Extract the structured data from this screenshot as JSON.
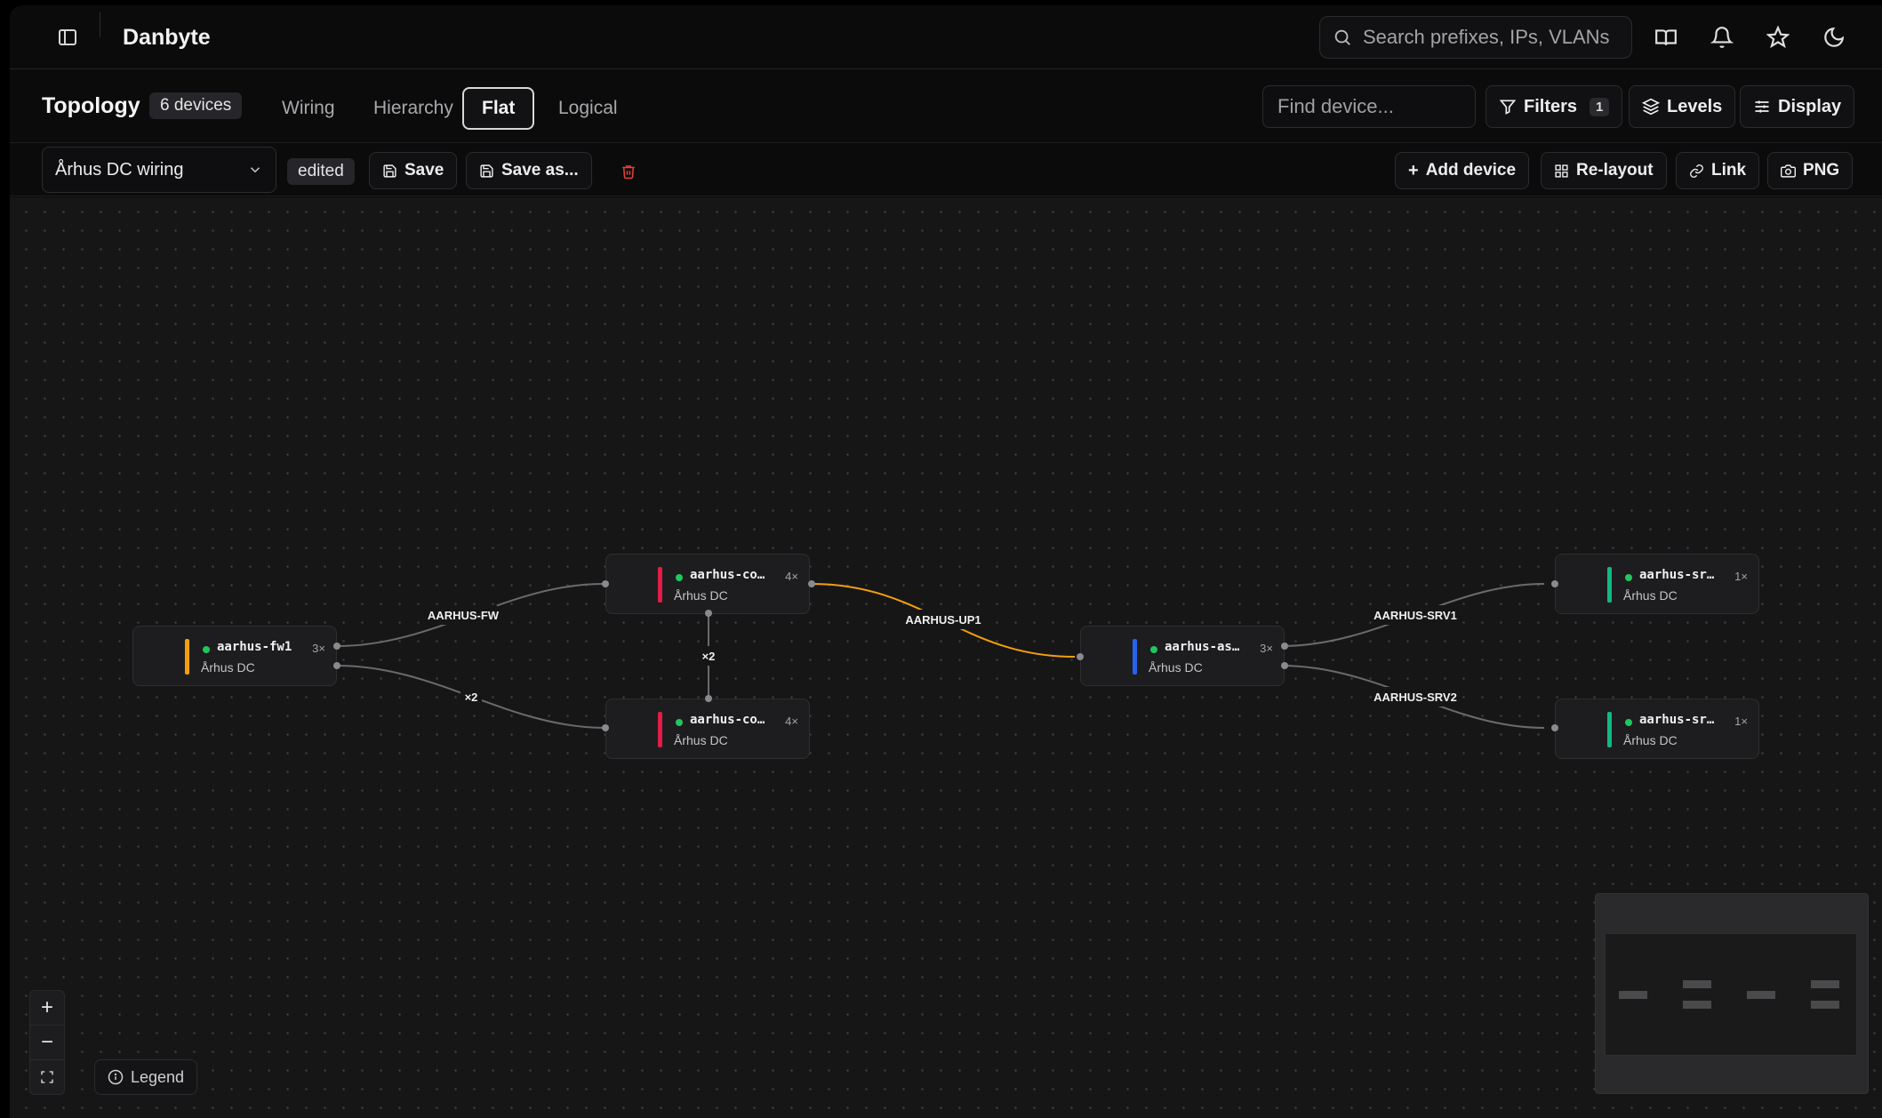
{
  "header": {
    "brand": "Danbyte",
    "search_placeholder": "Search prefixes, IPs, VLANs",
    "icons": [
      "sidebar-toggle-icon",
      "book-icon",
      "bell-icon",
      "star-icon",
      "moon-icon"
    ]
  },
  "view": {
    "title": "Topology",
    "device_count": "6 devices",
    "tabs": [
      {
        "label": "Wiring",
        "active": false
      },
      {
        "label": "Hierarchy",
        "active": false
      },
      {
        "label": "Flat",
        "active": true
      },
      {
        "label": "Logical",
        "active": false
      }
    ],
    "find_placeholder": "Find device...",
    "filters_label": "Filters",
    "filters_count": "1",
    "levels_label": "Levels",
    "display_label": "Display"
  },
  "toolbar": {
    "layout_name": "Århus DC wiring",
    "status": "edited",
    "save_label": "Save",
    "save_as_label": "Save as...",
    "add_device_label": "Add device",
    "relayout_label": "Re-layout",
    "link_label": "Link",
    "png_label": "PNG"
  },
  "nodes": [
    {
      "id": "fw1",
      "name": "aarhus-fw1",
      "site": "Århus DC",
      "ports": "3×",
      "color": "#f59e0b"
    },
    {
      "id": "co1",
      "name": "aarhus-co…",
      "site": "Århus DC",
      "ports": "4×",
      "color": "#e11d48"
    },
    {
      "id": "co2",
      "name": "aarhus-co…",
      "site": "Århus DC",
      "ports": "4×",
      "color": "#e11d48"
    },
    {
      "id": "as1",
      "name": "aarhus-as…",
      "site": "Århus DC",
      "ports": "3×",
      "color": "#2563eb"
    },
    {
      "id": "sr1",
      "name": "aarhus-sr…",
      "site": "Århus DC",
      "ports": "1×",
      "color": "#10b981"
    },
    {
      "id": "sr2",
      "name": "aarhus-sr…",
      "site": "Århus DC",
      "ports": "1×",
      "color": "#10b981"
    }
  ],
  "edges": [
    {
      "label": "AARHUS-FW",
      "color": "#6b6b6e"
    },
    {
      "label": "×2",
      "color": "#6b6b6e"
    },
    {
      "label": "×2",
      "color": "#6b6b6e"
    },
    {
      "label": "AARHUS-UP1",
      "color": "#f59e0b"
    },
    {
      "label": "AARHUS-SRV1",
      "color": "#6b6b6e"
    },
    {
      "label": "AARHUS-SRV2",
      "color": "#6b6b6e"
    }
  ],
  "controls": {
    "zoom_in": "+",
    "zoom_out": "−",
    "legend_label": "Legend"
  }
}
